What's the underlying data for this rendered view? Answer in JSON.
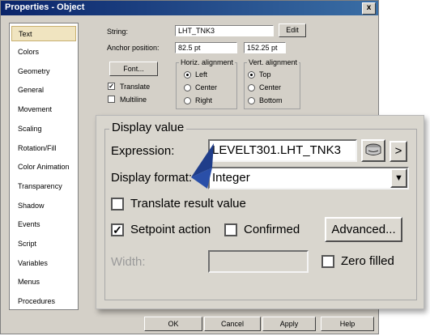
{
  "window": {
    "title": "Properties - Object",
    "close_label": "x"
  },
  "sidebar": {
    "items": [
      {
        "label": "Text",
        "selected": true
      },
      {
        "label": "Colors"
      },
      {
        "label": "Geometry"
      },
      {
        "label": "General"
      },
      {
        "label": "Movement"
      },
      {
        "label": "Scaling"
      },
      {
        "label": "Rotation/Fill"
      },
      {
        "label": "Color Animation"
      },
      {
        "label": "Transparency"
      },
      {
        "label": "Shadow"
      },
      {
        "label": "Events"
      },
      {
        "label": "Script"
      },
      {
        "label": "Variables"
      },
      {
        "label": "Menus"
      },
      {
        "label": "Procedures"
      }
    ]
  },
  "text_panel": {
    "string_label": "String:",
    "string_value": "LHT_TNK3",
    "edit_label": "Edit",
    "anchor_label": "Anchor position:",
    "anchor_x": "82.5 pt",
    "anchor_y": "152.25 pt",
    "font_label": "Font...",
    "translate_label": "Translate",
    "translate_checked": true,
    "multiline_label": "Multiline",
    "multiline_checked": false,
    "horiz": {
      "title": "Horiz. alignment",
      "options": [
        "Left",
        "Center",
        "Right"
      ],
      "selected": "Left"
    },
    "vert": {
      "title": "Vert. alignment",
      "options": [
        "Top",
        "Center",
        "Bottom"
      ],
      "selected": "Top"
    }
  },
  "display_value": {
    "title": "Display value",
    "expression_label": "Expression:",
    "expression_value": "LEVELT301.LHT_TNK3",
    "browse_icon": "tag-browse-icon",
    "next_label": ">",
    "format_label": "Display format:",
    "format_value": "Integer",
    "translate_result_label": "Translate result value",
    "translate_result_checked": false,
    "setpoint_label": "Setpoint action",
    "setpoint_checked": true,
    "confirmed_label": "Confirmed",
    "confirmed_checked": false,
    "advanced_label": "Advanced...",
    "width_label": "Width:",
    "width_value": "",
    "zero_filled_label": "Zero filled",
    "zero_filled_checked": false
  },
  "footer": {
    "ok": "OK",
    "cancel": "Cancel",
    "apply": "Apply",
    "help": "Help"
  },
  "colors": {
    "title_start": "#0a246a",
    "title_end": "#3a6ea5",
    "selected_item": "#f0e4c0",
    "pointer": "#1f3d8a"
  }
}
